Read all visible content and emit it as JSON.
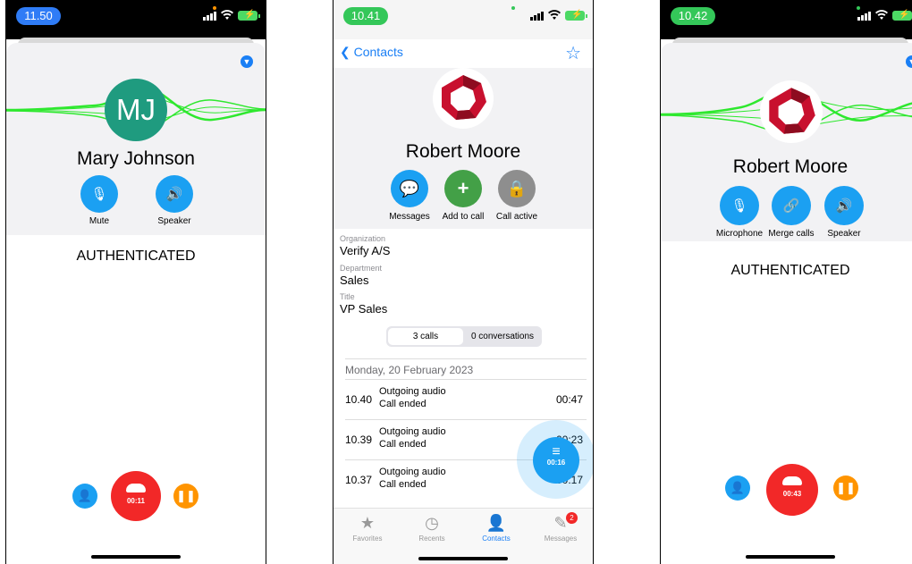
{
  "phone1": {
    "status_time": "11.50",
    "contact_initials": "MJ",
    "contact_name": "Mary Johnson",
    "controls": [
      {
        "label": "Mute",
        "icon": "microphone-icon"
      },
      {
        "label": "Speaker",
        "icon": "speaker-icon"
      }
    ],
    "status_text": "AUTHENTICATED",
    "call_timer": "00:11",
    "left_action_icon": "add-participant-icon",
    "right_action_icon": "pause-icon"
  },
  "phone2": {
    "status_time": "10.41",
    "back_label": "Contacts",
    "favorite_icon": "star-icon",
    "contact_name": "Robert Moore",
    "actions": [
      {
        "label": "Messages",
        "icon": "chat-icon",
        "color": "#1ba0f2"
      },
      {
        "label": "Add to call",
        "icon": "plus-icon",
        "color": "#43a047"
      },
      {
        "label": "Call active",
        "icon": "lock-icon",
        "color": "#8e8e8e"
      }
    ],
    "fields": [
      {
        "label": "Organization",
        "value": "Verify A/S"
      },
      {
        "label": "Department",
        "value": "Sales"
      },
      {
        "label": "Title",
        "value": "VP Sales"
      }
    ],
    "segments": {
      "calls": "3 calls",
      "conversations": "0 conversations"
    },
    "date_header": "Monday, 20 February 2023",
    "calls": [
      {
        "time": "10.40",
        "type": "Outgoing audio",
        "status": "Call ended",
        "duration": "00:47"
      },
      {
        "time": "10.39",
        "type": "Outgoing audio",
        "status": "Call ended",
        "duration": "00:23"
      },
      {
        "time": "10.37",
        "type": "Outgoing audio",
        "status": "Call ended",
        "duration": "00:17"
      }
    ],
    "fab_timer": "00:16",
    "tabs": [
      {
        "label": "Favorites",
        "icon": "star-icon"
      },
      {
        "label": "Recents",
        "icon": "clock-icon"
      },
      {
        "label": "Contacts",
        "icon": "person-icon",
        "active": true
      },
      {
        "label": "Messages",
        "icon": "compose-icon",
        "badge": "2"
      }
    ]
  },
  "phone3": {
    "status_time": "10.42",
    "contact_name": "Robert Moore",
    "controls": [
      {
        "label": "Microphone",
        "icon": "microphone-icon"
      },
      {
        "label": "Merge calls",
        "icon": "link-icon"
      },
      {
        "label": "Speaker",
        "icon": "speaker-icon"
      }
    ],
    "status_text": "AUTHENTICATED",
    "call_timer": "00:43",
    "left_action_icon": "add-participant-icon",
    "right_action_icon": "pause-icon"
  },
  "colors": {
    "accent_blue": "#1ba0f2",
    "end_call_red": "#f22828",
    "pause_orange": "#ff9400",
    "waveform_green": "#2ee82e",
    "avatar_teal": "#1f9b7f",
    "logo_red": "#c8102e"
  }
}
